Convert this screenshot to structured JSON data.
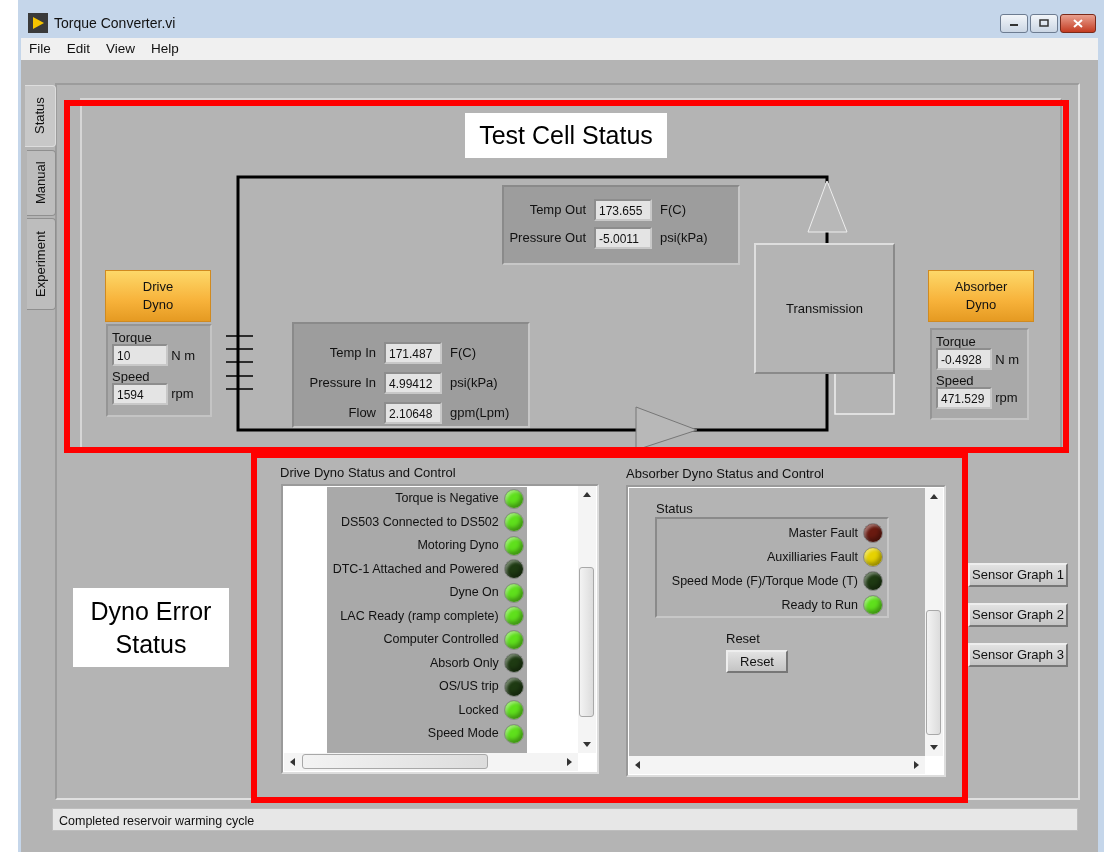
{
  "window": {
    "title": "Torque Converter.vi"
  },
  "menu": [
    "File",
    "Edit",
    "View",
    "Help"
  ],
  "tabs": [
    {
      "label": "Status",
      "selected": true
    },
    {
      "label": "Manual",
      "selected": false
    },
    {
      "label": "Experiment",
      "selected": false
    }
  ],
  "callouts": [
    "Test Cell Status",
    "Dyno Error Status"
  ],
  "drive_dyno": {
    "button_lines": [
      "Drive",
      "Dyno"
    ],
    "readings": [
      {
        "label": "Torque",
        "value": "10",
        "unit": "N m"
      },
      {
        "label": "Speed",
        "value": "1594",
        "unit": "rpm"
      }
    ]
  },
  "absorber_dyno": {
    "button_lines": [
      "Absorber",
      "Dyno"
    ],
    "readings": [
      {
        "label": "Torque",
        "value": "-0.4928",
        "unit": "N m"
      },
      {
        "label": "Speed",
        "value": "471.529",
        "unit": "rpm"
      }
    ]
  },
  "outlet": [
    {
      "label": "Temp Out",
      "value": "173.655",
      "unit": "F(C)"
    },
    {
      "label": "Pressure Out",
      "value": "-5.0011",
      "unit": "psi(kPa)"
    }
  ],
  "inlet": [
    {
      "label": "Temp In",
      "value": "171.487",
      "unit": "F(C)"
    },
    {
      "label": "Pressure In",
      "value": "4.99412",
      "unit": "psi(kPa)"
    },
    {
      "label": "Flow",
      "value": "2.10648",
      "unit": "gpm(Lpm)"
    }
  ],
  "transmission": "Transmission",
  "drive_status": {
    "title": "Drive Dyno Status and Control",
    "indicators": [
      {
        "label": "Torque is Negative",
        "color": "#5fe01c"
      },
      {
        "label": "DS503 Connected to DS502",
        "color": "#5fe01c"
      },
      {
        "label": "Motoring Dyno",
        "color": "#5fe01c"
      },
      {
        "label": "DTC-1 Attached and Powered",
        "color": "#1e3a12"
      },
      {
        "label": "Dyne On",
        "color": "#5fe01c"
      },
      {
        "label": "LAC Ready (ramp complete)",
        "color": "#5fe01c"
      },
      {
        "label": "Computer Controlled",
        "color": "#5fe01c"
      },
      {
        "label": "Absorb Only",
        "color": "#1e3a12"
      },
      {
        "label": "OS/US trip",
        "color": "#1e3a12"
      },
      {
        "label": "Locked",
        "color": "#5fe01c"
      },
      {
        "label": "Speed Mode",
        "color": "#5fe01c"
      }
    ]
  },
  "absorber_status": {
    "title": "Absorber Dyno Status and Control",
    "group_label": "Status",
    "indicators": [
      {
        "label": "Master Fault",
        "color": "#6a1a10"
      },
      {
        "label": "Auxilliaries Fault",
        "color": "#e6d200"
      },
      {
        "label": "Speed Mode (F)/Torque Mode (T)",
        "color": "#1e3a12"
      },
      {
        "label": "Ready to Run",
        "color": "#5fe01c"
      }
    ],
    "reset_label": "Reset",
    "reset_button": "Reset"
  },
  "sensor_buttons": [
    "Sensor Graph 1",
    "Sensor Graph 2",
    "Sensor Graph 3"
  ],
  "status_bar": "Completed reservoir warming cycle"
}
